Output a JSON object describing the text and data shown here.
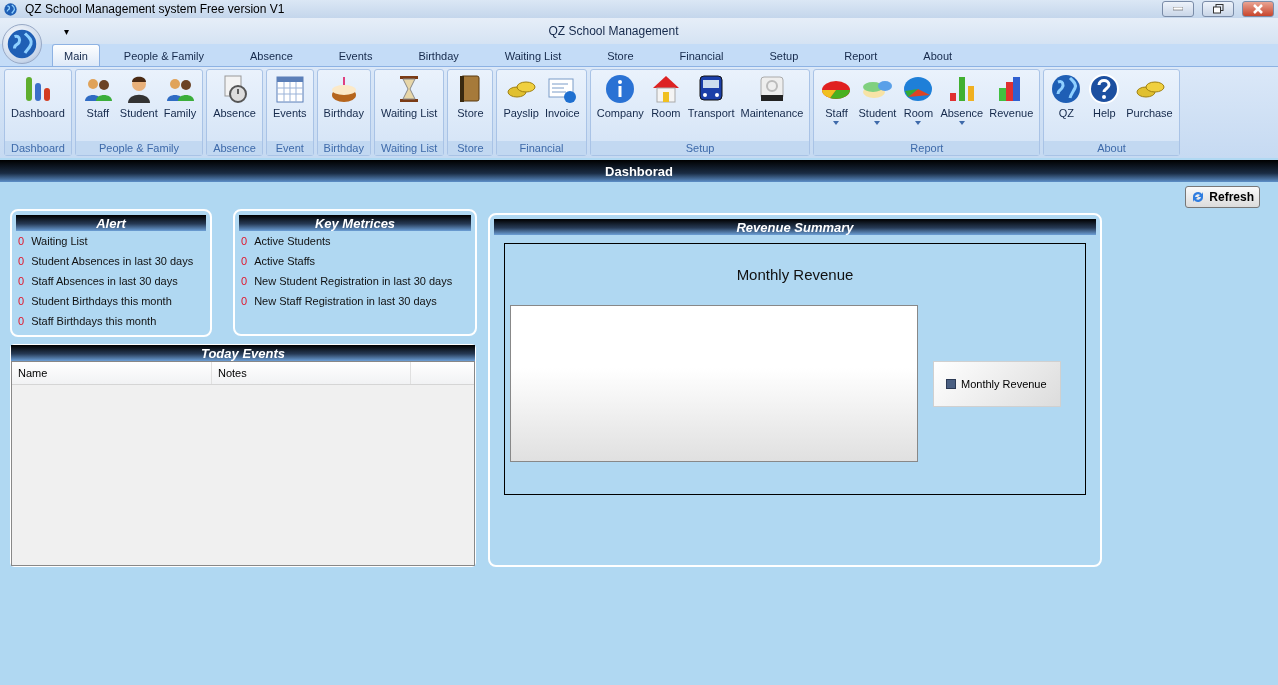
{
  "window": {
    "title": "QZ School Management system Free version V1",
    "app_title": "QZ School Management",
    "quick_access": "▾"
  },
  "tabs": [
    {
      "label": "Main",
      "selected": true
    },
    {
      "label": "People & Family",
      "selected": false
    },
    {
      "label": "Absence",
      "selected": false
    },
    {
      "label": "Events",
      "selected": false
    },
    {
      "label": "Birthday",
      "selected": false
    },
    {
      "label": "Waiting List",
      "selected": false
    },
    {
      "label": "Store",
      "selected": false
    },
    {
      "label": "Financial",
      "selected": false
    },
    {
      "label": "Setup",
      "selected": false
    },
    {
      "label": "Report",
      "selected": false
    },
    {
      "label": "About",
      "selected": false
    }
  ],
  "ribbon_groups": [
    {
      "label": "Dashboard",
      "items": [
        {
          "label": "Dashboard",
          "dropdown": false
        }
      ]
    },
    {
      "label": "People & Family",
      "items": [
        {
          "label": "Staff",
          "dropdown": false
        },
        {
          "label": "Student",
          "dropdown": false
        },
        {
          "label": "Family",
          "dropdown": false
        }
      ]
    },
    {
      "label": "Absence",
      "items": [
        {
          "label": "Absence",
          "dropdown": false
        }
      ]
    },
    {
      "label": "Event",
      "items": [
        {
          "label": "Events",
          "dropdown": false
        }
      ]
    },
    {
      "label": "Birthday",
      "items": [
        {
          "label": "Birthday",
          "dropdown": false
        }
      ]
    },
    {
      "label": "Waiting List",
      "items": [
        {
          "label": "Waiting List",
          "dropdown": false
        }
      ]
    },
    {
      "label": "Store",
      "items": [
        {
          "label": "Store",
          "dropdown": false
        }
      ]
    },
    {
      "label": "Financial",
      "items": [
        {
          "label": "Payslip",
          "dropdown": false
        },
        {
          "label": "Invoice",
          "dropdown": false
        }
      ]
    },
    {
      "label": "Setup",
      "items": [
        {
          "label": "Company",
          "dropdown": false
        },
        {
          "label": "Room",
          "dropdown": false
        },
        {
          "label": "Transport",
          "dropdown": false
        },
        {
          "label": "Maintenance",
          "dropdown": false
        }
      ]
    },
    {
      "label": "Report",
      "items": [
        {
          "label": "Staff",
          "dropdown": true
        },
        {
          "label": "Student",
          "dropdown": true
        },
        {
          "label": "Room",
          "dropdown": true
        },
        {
          "label": "Absence",
          "dropdown": true
        },
        {
          "label": "Revenue",
          "dropdown": false
        }
      ]
    },
    {
      "label": "About",
      "items": [
        {
          "label": "QZ",
          "dropdown": false
        },
        {
          "label": "Help",
          "dropdown": false
        },
        {
          "label": "Purchase",
          "dropdown": false
        }
      ]
    }
  ],
  "page_title": "Dashborad",
  "refresh_button": "Refresh",
  "alert": {
    "title": "Alert",
    "rows": [
      {
        "count": "0",
        "label": "Waiting List"
      },
      {
        "count": "0",
        "label": "Student Absences in last 30 days"
      },
      {
        "count": "0",
        "label": "Staff Absences in last 30 days"
      },
      {
        "count": "0",
        "label": "Student Birthdays  this month"
      },
      {
        "count": "0",
        "label": "Staff Birthdays  this month"
      }
    ]
  },
  "key_metrics": {
    "title": "Key Metrices",
    "rows": [
      {
        "count": "0",
        "label": "Active Students"
      },
      {
        "count": "0",
        "label": "Active Staffs"
      },
      {
        "count": "0",
        "label": "New Student Registration in last 30 days"
      },
      {
        "count": "0",
        "label": "New Staff Registration in last 30 days"
      }
    ]
  },
  "today_events": {
    "title": "Today Events",
    "columns": [
      "Name",
      "Notes"
    ]
  },
  "revenue_summary": {
    "title": "Revenue Summary",
    "chart_title": "Monthly Revenue",
    "legend": [
      "Monthly Revenue"
    ]
  }
}
